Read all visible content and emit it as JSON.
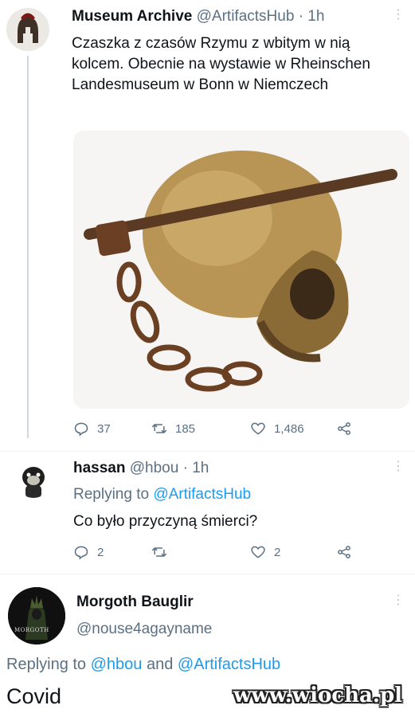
{
  "tweet1": {
    "name": "Museum Archive",
    "handle": "@ArtifactsHub",
    "time": "· 1h",
    "text": "Czaszka z czasów Rzymu z wbitym w nią kolcem. Obecnie na wystawie w Rheinschen Landesmuseum w Bonn w Niemczech",
    "replies": "37",
    "retweets": "185",
    "likes": "1,486",
    "avatar_icon": "spartan-helmet-icon",
    "image_icon": "skull-with-spike-photo"
  },
  "reply1": {
    "name": "hassan",
    "handle": "@hbou",
    "time": "· 1h",
    "replying_prefix": "Replying to",
    "replying_to": "@ArtifactsHub",
    "text": "Co było przyczyną śmierci?",
    "replies": "2",
    "likes": "2",
    "avatar_icon": "pug-avatar-icon"
  },
  "reply2": {
    "name": "Morgoth Bauglir",
    "handle": "@nouse4agayname",
    "replying_prefix": "Replying to",
    "replying_to_1": "@hbou",
    "and": "and",
    "replying_to_2": "@ArtifactsHub",
    "text": "Covid",
    "avatar_text": "MORGOTH",
    "avatar_icon": "dark-lord-avatar-icon"
  },
  "watermark": "www.wiocha.pl",
  "colors": {
    "link": "#1d9bf0",
    "muted": "#5b7083",
    "thread_line": "#cfd9de"
  }
}
